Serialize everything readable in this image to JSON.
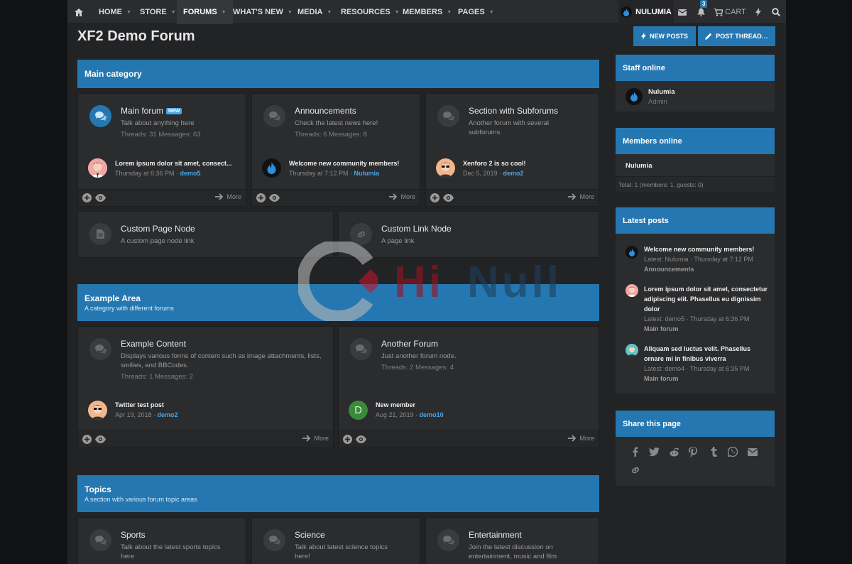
{
  "nav": {
    "home_icon": "home-icon",
    "items": [
      {
        "label": "Home"
      },
      {
        "label": "Store"
      },
      {
        "label": "Forums"
      },
      {
        "label": "What's new"
      },
      {
        "label": "Media"
      },
      {
        "label": "Resources"
      },
      {
        "label": "Members"
      },
      {
        "label": "Pages"
      }
    ],
    "active": "Forums",
    "user": "NULUMIA",
    "alerts_count": "3",
    "cart_label": "CART",
    "icons": [
      "mail-icon",
      "bell-icon",
      "cart-icon",
      "bolt-icon",
      "search-icon"
    ]
  },
  "page": {
    "title": "XF2 Demo Forum",
    "new_posts": "NEW POSTS",
    "post_thread": "POST THREAD…"
  },
  "main_category": {
    "title": "Main category",
    "forums": [
      {
        "name": "Main forum",
        "badge": "NEW",
        "desc": "Talk about anything here",
        "stats": "Threads: 31 Messages: 63",
        "last_title": "Lorem ipsum dolor sit amet, consect...",
        "last_date": "Thursday at 6:36 PM",
        "last_user": "demo5"
      },
      {
        "name": "Announcements",
        "desc": "Check the latest news here!",
        "stats": "Threads: 6 Messages: 8",
        "last_title": "Welcome new community members!",
        "last_date": "Thursday at 7:12 PM",
        "last_user": "Nulumia"
      },
      {
        "name": "Section with Subforums",
        "desc": "Another forum with several subforums.",
        "last_title": "Xenforo 2 is so cool!",
        "last_date": "Dec 5, 2019",
        "last_user": "demo2"
      }
    ],
    "more": "More",
    "page_node": {
      "name": "Custom Page Node",
      "desc": "A custom page node link"
    },
    "link_node": {
      "name": "Custom Link Node",
      "desc": "A page link"
    }
  },
  "example_area": {
    "title": "Example Area",
    "desc": "A category with different forums",
    "forums": [
      {
        "name": "Example Content",
        "desc": "Displays various forms of content such as image attachments, lists, smilies, and BBCodes.",
        "stats": "Threads: 1 Messages: 2",
        "last_title": "Twitter test post",
        "last_date": "Apr 19, 2018",
        "last_user": "demo2"
      },
      {
        "name": "Another Forum",
        "desc": "Just another forum node.",
        "stats": "Threads: 2 Messages: 4",
        "last_title": "New member",
        "last_date": "Aug 21, 2019",
        "last_user": "demo10",
        "avatar_letter": "D"
      }
    ]
  },
  "topics": {
    "title": "Topics",
    "desc": "A section with various forum topic areas",
    "forums": [
      {
        "name": "Sports",
        "desc": "Talk about the latest sports topics here"
      },
      {
        "name": "Science",
        "desc": "Talk about latest science topics here!"
      },
      {
        "name": "Entertainment",
        "desc": "Join the latest discussion on entertainment, music and film"
      }
    ]
  },
  "sidebar": {
    "staff": {
      "title": "Staff online",
      "name": "Nulumia",
      "role": "Admin"
    },
    "members": {
      "title": "Members online",
      "name": "Nulumia",
      "total": "Total: 1 (members: 1, guests: 0)"
    },
    "latest": {
      "title": "Latest posts",
      "posts": [
        {
          "title": "Welcome new community members!",
          "meta": "Latest: Nulumia · Thursday at 7:12 PM",
          "forum": "Announcements"
        },
        {
          "title": "Lorem ipsum dolor sit amet, consectetur adipiscing elit. Phasellus eu dignissim dolor",
          "meta": "Latest: demo5 · Thursday at 6:36 PM",
          "forum": "Main forum"
        },
        {
          "title": "Aliquam sed luctus velit. Phasellus ornare mi in finibus viverra",
          "meta": "Latest: demo4 · Thursday at 6:35 PM",
          "forum": "Main forum"
        }
      ]
    },
    "share": {
      "title": "Share this page",
      "icons": [
        "facebook-icon",
        "twitter-icon",
        "reddit-icon",
        "pinterest-icon",
        "tumblr-icon",
        "whatsapp-icon",
        "email-icon",
        "link-icon"
      ]
    }
  },
  "watermark": {
    "text1": "Hi",
    "text2": "Null"
  },
  "colors": {
    "accent": "#2577b1",
    "link": "#47a7eb",
    "background": "#222325",
    "card": "#2b2c2e"
  }
}
